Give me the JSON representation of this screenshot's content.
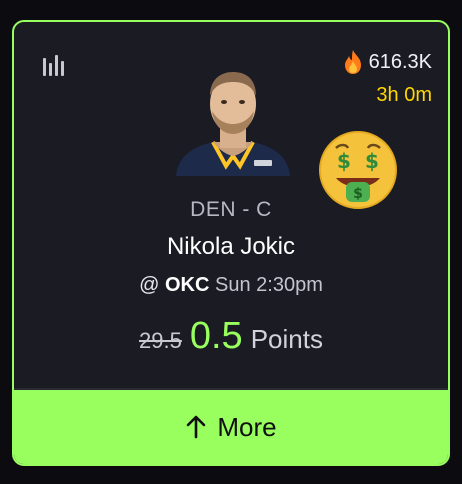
{
  "card": {
    "popularity": "616.3K",
    "timer": "3h 0m",
    "team_position": "DEN - C",
    "player_name": "Nikola Jokic",
    "matchup_prefix": "@",
    "opponent": "OKC",
    "game_time": "Sun 2:30pm",
    "old_line": "29.5",
    "new_line": "0.5",
    "stat_type": "Points",
    "more_label": "More",
    "accent_color": "#98ff5f",
    "timer_color": "#ffd600",
    "stats_icon": "bar-chart-icon",
    "fire_icon": "fire-icon",
    "emoji_icon": "money-mouth-face-icon",
    "arrow_icon": "arrow-up-icon"
  }
}
